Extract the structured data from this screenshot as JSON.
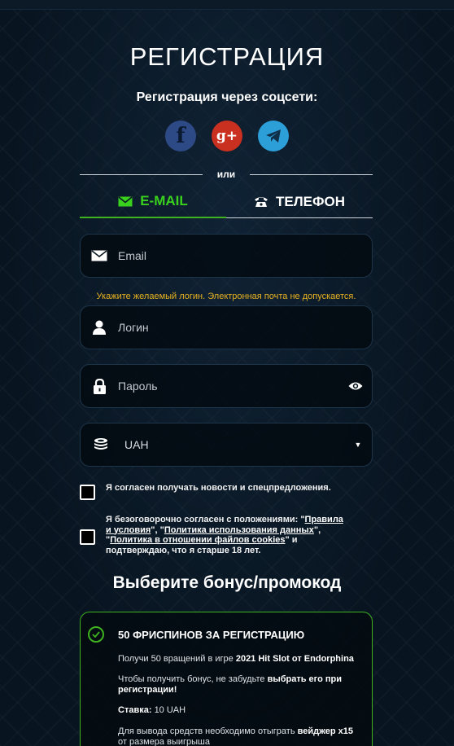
{
  "page": {
    "title": "РЕГИСТРАЦИЯ",
    "social_title": "Регистрация через соцсети:",
    "socials": [
      {
        "name": "facebook",
        "icon": "facebook-icon",
        "glyph": "f",
        "color": "#2e4a86"
      },
      {
        "name": "google-plus",
        "icon": "google-plus-icon",
        "glyph": "g+",
        "color": "#c9301f"
      },
      {
        "name": "telegram",
        "icon": "telegram-icon",
        "color": "#2d9fd8"
      }
    ],
    "divider_text": "или"
  },
  "tabs": [
    {
      "label": "E-MAIL",
      "icon": "envelope-icon",
      "active": true
    },
    {
      "label": "ТЕЛЕФОН",
      "icon": "phone-icon",
      "active": false
    }
  ],
  "form": {
    "email": {
      "placeholder": "Email",
      "value": ""
    },
    "login_hint": "Укажите желаемый логин. Электронная почта не допускается.",
    "login": {
      "placeholder": "Логин",
      "value": ""
    },
    "password": {
      "placeholder": "Пароль",
      "value": ""
    },
    "currency": {
      "value": "UAH",
      "icon": "coins-icon"
    }
  },
  "consents": {
    "news": {
      "text": "Я согласен получать новости и спецпредложения.",
      "checked": false
    },
    "terms": {
      "checked": false,
      "prefix": "Я безоговорочно согласен с положениями: \"",
      "link1": "Правила и условия",
      "sep1": "\", \"",
      "link2": "Политика использования данных",
      "sep2": "\", \"",
      "link3": "Политика в отношении файлов cookies",
      "suffix": "\" и подтверждаю, что я старше 18 лет."
    }
  },
  "bonus": {
    "section_title": "Выберите бонус/промокод",
    "card": {
      "selected": true,
      "title": "50 ФРИСПИНОВ ЗА РЕГИСТРАЦИЮ",
      "line1_pre": "Получи 50 вращений в игре",
      "line1_bold": "2021 Hit Slot от Endorphina",
      "line2_pre": "Чтобы получить бонус, не забудьте",
      "line2_bold": "выбрать его при регистрации!",
      "stake_label": "Ставка:",
      "stake_value": "10 UAH",
      "line4_pre": "Для вывода средств необходимо отыграть",
      "line4_bold": "вейджер x15",
      "line4_post": "от размера выигрыша"
    }
  },
  "colors": {
    "accent": "#39d11d",
    "warning": "#e8b320",
    "border": "#1e3448"
  }
}
